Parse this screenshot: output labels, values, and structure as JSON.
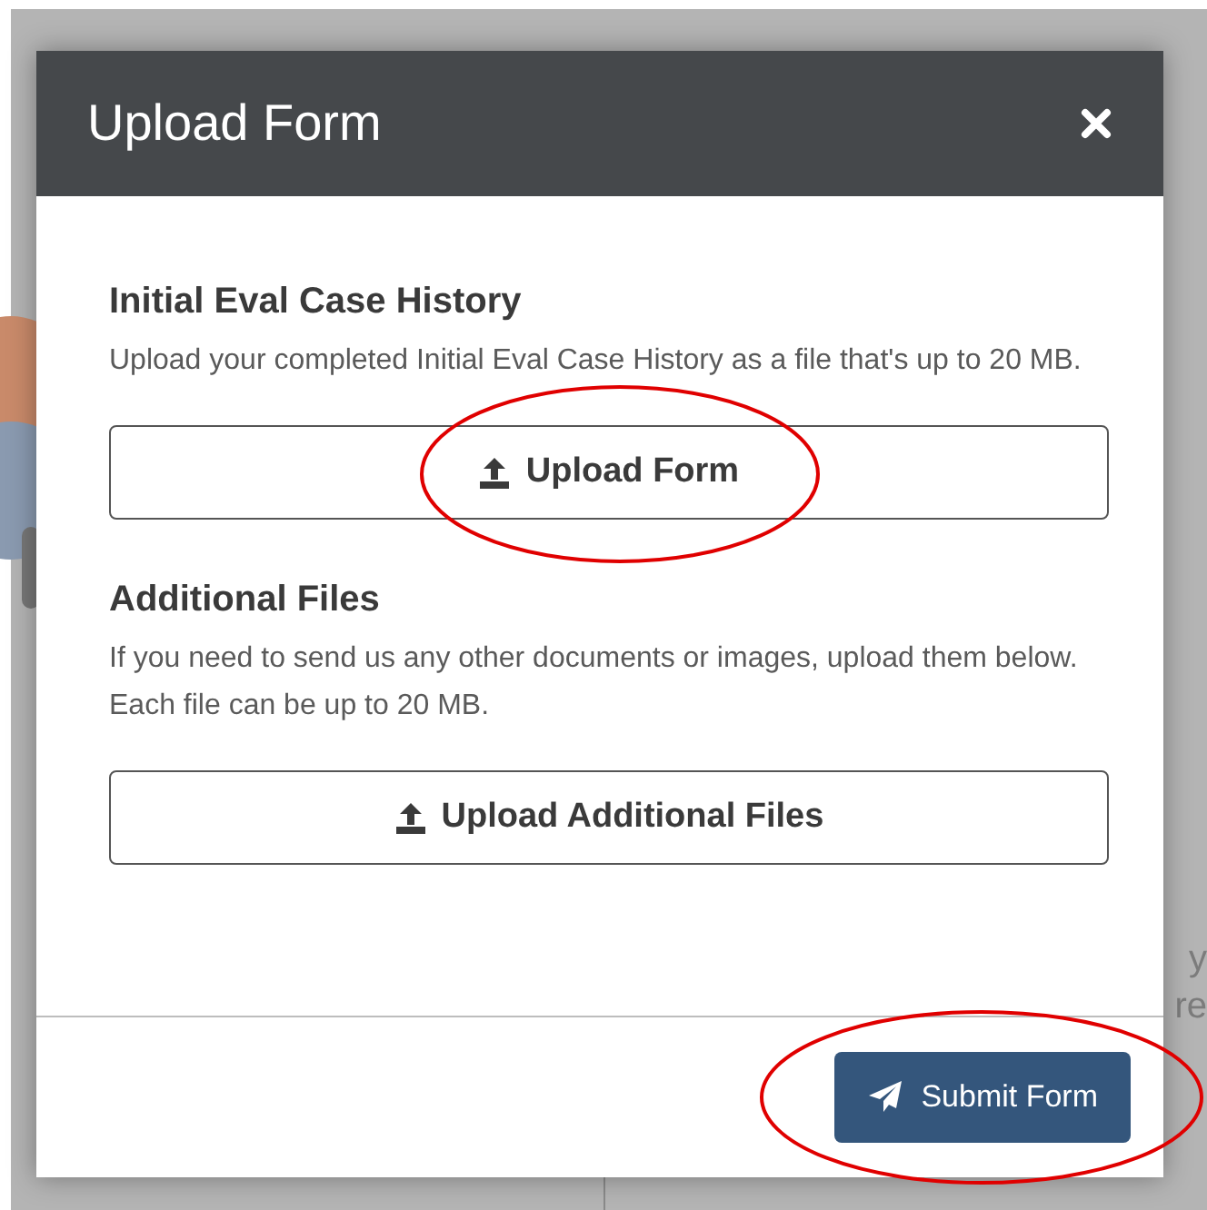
{
  "background": {
    "right_fragments": [
      "y",
      "re"
    ]
  },
  "modal": {
    "title": "Upload Form",
    "sections": [
      {
        "heading": "Initial Eval Case History",
        "description": "Upload your completed Initial Eval Case History as a file that's up to 20 MB.",
        "button": "Upload Form",
        "circled": true
      },
      {
        "heading": "Additional Files",
        "description": "If you need to send us any other documents or images, upload them below. Each file can be up to 20 MB.",
        "button": "Upload Additional Files",
        "circled": false
      }
    ],
    "submit": {
      "label": "Submit Form",
      "circled": true
    }
  }
}
